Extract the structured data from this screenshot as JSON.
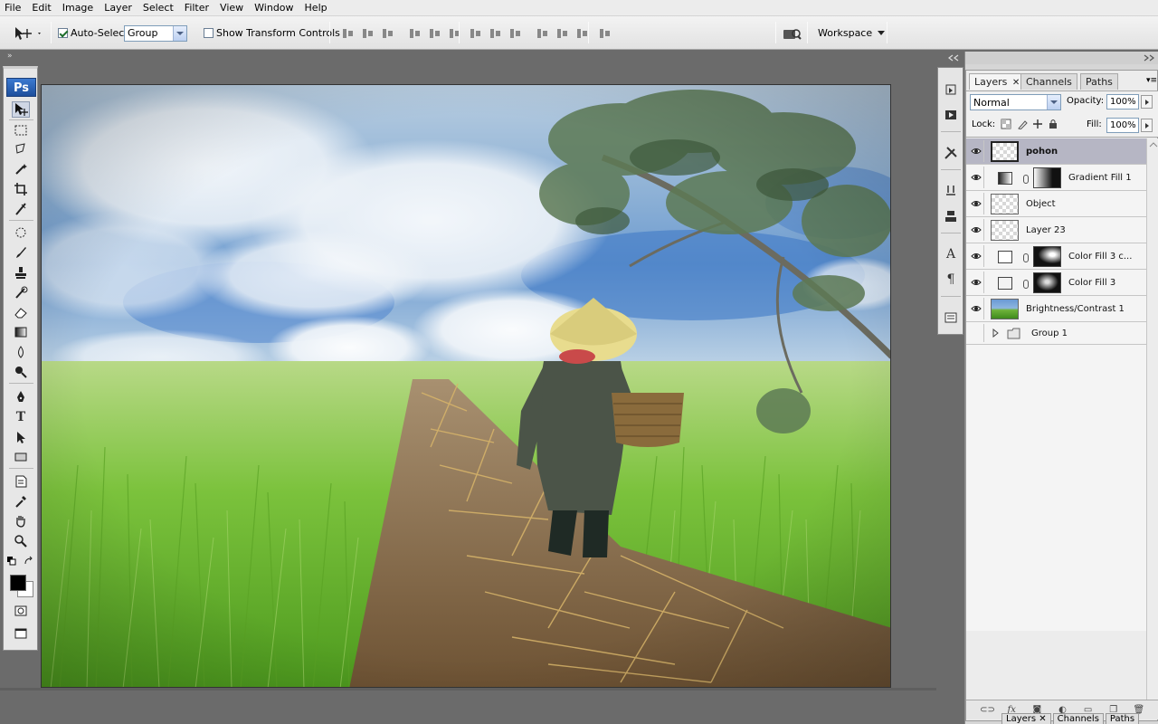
{
  "menu": [
    "File",
    "Edit",
    "Image",
    "Layer",
    "Select",
    "Filter",
    "View",
    "Window",
    "Help"
  ],
  "options_bar": {
    "auto_select_label": "Auto-Select:",
    "auto_select_checked": true,
    "auto_select_value": "Group",
    "show_transform_label": "Show Transform Controls",
    "show_transform_checked": false,
    "workspace_label": "Workspace"
  },
  "tools": {
    "logo": "Ps"
  },
  "layers_panel": {
    "tabs": [
      "Layers",
      "Channels",
      "Paths"
    ],
    "active_tab": "Layers",
    "blend_mode": "Normal",
    "opacity_label": "Opacity:",
    "opacity_value": "100%",
    "lock_label": "Lock:",
    "fill_label": "Fill:",
    "fill_value": "100%",
    "layers": [
      {
        "name": "pohon",
        "type": "pixel",
        "visible": true,
        "selected": true
      },
      {
        "name": "Gradient Fill 1",
        "type": "gradient-fill",
        "visible": true,
        "selected": false
      },
      {
        "name": "Object",
        "type": "pixel",
        "visible": true,
        "selected": false
      },
      {
        "name": "Layer 23",
        "type": "pixel",
        "visible": true,
        "selected": false
      },
      {
        "name": "Color Fill 3 c...",
        "type": "color-fill",
        "visible": true,
        "selected": false
      },
      {
        "name": "Color Fill 3",
        "type": "color-fill",
        "visible": true,
        "selected": false
      },
      {
        "name": "Brightness/Contrast 1",
        "type": "adjustment",
        "visible": true,
        "selected": false
      },
      {
        "name": "Group 1",
        "type": "group",
        "visible": false,
        "selected": false
      }
    ],
    "bottom_tabs": [
      "Layers",
      "Channels",
      "Paths"
    ]
  },
  "colors": {
    "menubar": "#ececec",
    "workspace_bg": "#6b6b6b",
    "selected_layer": "#b6b6c4",
    "ps_logo": "#2a62b8"
  }
}
